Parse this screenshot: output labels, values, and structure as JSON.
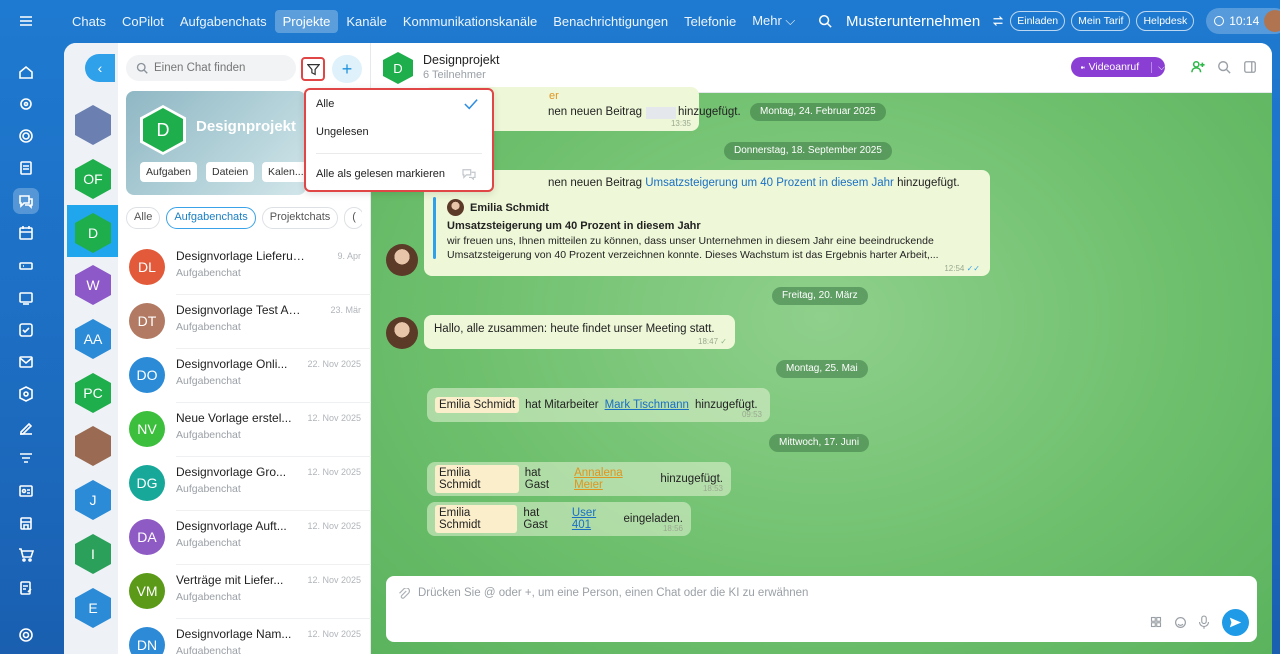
{
  "topnav": {
    "items": [
      "Chats",
      "CoPilot",
      "Aufgabenchats",
      "Projekte",
      "Kanäle",
      "Kommunikationskanäle",
      "Benachrichtigungen",
      "Telefonie",
      "Mehr ⌵"
    ],
    "active_index": 3
  },
  "header_right": {
    "org_name": "Musterunternehmen",
    "invite": "Einladen",
    "tariff": "Mein Tarif",
    "helpdesk": "Helpdesk",
    "time": "10:14"
  },
  "chatlist": {
    "search_placeholder": "Einen Chat finden",
    "banner": {
      "letter": "D",
      "title": "Designprojekt",
      "chips": [
        "Aufgaben",
        "Dateien",
        "Kalen..."
      ]
    },
    "tabs": [
      "Alle",
      "Aufgabenchats",
      "Projektchats",
      "("
    ],
    "rows": [
      {
        "initials": "DL",
        "title": "Designvorlage Lieferung ...",
        "subtitle": "Aufgabenchat",
        "date": "9. Apr",
        "color": "#e25a3a"
      },
      {
        "initials": "DT",
        "title": "Designvorlage Test Auft...",
        "subtitle": "Aufgabenchat",
        "date": "23. Mär",
        "color": "#b27a62"
      },
      {
        "initials": "DO",
        "title": "Designvorlage Onli...",
        "subtitle": "Aufgabenchat",
        "date": "22. Nov 2025",
        "color": "#2b8bd6"
      },
      {
        "initials": "NV",
        "title": "Neue Vorlage erstel...",
        "subtitle": "Aufgabenchat",
        "date": "12. Nov 2025",
        "color": "#3cbf3c"
      },
      {
        "initials": "DG",
        "title": "Designvorlage Gro...",
        "subtitle": "Aufgabenchat",
        "date": "12. Nov 2025",
        "color": "#17a89a"
      },
      {
        "initials": "DA",
        "title": "Designvorlage Auft...",
        "subtitle": "Aufgabenchat",
        "date": "12. Nov 2025",
        "color": "#8e5ac4"
      },
      {
        "initials": "VM",
        "title": "Verträge mit Liefer...",
        "subtitle": "Aufgabenchat",
        "date": "12. Nov 2025",
        "color": "#5a9a18"
      },
      {
        "initials": "DN",
        "title": "Designvorlage Nam...",
        "subtitle": "Aufgabenchat",
        "date": "12. Nov 2025",
        "color": "#2d8ad6"
      }
    ]
  },
  "avatar_column": [
    {
      "label": "",
      "color": "#6b7fb0"
    },
    {
      "label": "OF",
      "color": "#1fae4c"
    },
    {
      "label": "D",
      "color": "#1fae4c"
    },
    {
      "label": "W",
      "color": "#8d58c7"
    },
    {
      "label": "AA",
      "color": "#2b8bd6"
    },
    {
      "label": "PC",
      "color": "#1fae4c"
    },
    {
      "label": "",
      "color": "#9a6a52"
    },
    {
      "label": "J",
      "color": "#2b8bd6"
    },
    {
      "label": "I",
      "color": "#2aa05a"
    },
    {
      "label": "E",
      "color": "#2b8bd6"
    }
  ],
  "filter_menu": {
    "all": "Alle",
    "unread": "Ungelesen",
    "mark_read": "Alle als gelesen markieren"
  },
  "chat_header": {
    "letter": "D",
    "title": "Designprojekt",
    "subtitle": "6 Teilnehmer",
    "video_call": "Videoanruf"
  },
  "messages": {
    "m1_sender_fragment": "er",
    "m1_text_before": "nen neuen Beitrag",
    "m1_text_after": "hinzugefügt.",
    "m1_time": "13:35",
    "date1": "Montag, 24. Februar 2025",
    "date2": "Donnerstag, 18. September 2025",
    "m2_text_before": "nen neuen Beitrag",
    "m2_link": "Umsatzsteigerung um 40 Prozent in diesem Jahr",
    "m2_text_after": "hinzugefügt.",
    "m2_quote_author": "Emilia Schmidt",
    "m2_quote_title": "Umsatzsteigerung um 40 Prozent in diesem Jahr",
    "m2_quote_line1": "wir freuen uns, Ihnen mitteilen zu können, dass unser Unternehmen in diesem Jahr eine beeindruckende",
    "m2_quote_line2": "Umsatzsteigerung von 40 Prozent verzeichnen konnte. Dieses Wachstum ist das Ergebnis harter Arbeit,...",
    "m2_time": "12:54",
    "date3": "Freitag, 20. März",
    "m3_text": "Hallo, alle zusammen: heute findet unser Meeting statt.",
    "m3_time": "18:47",
    "date4": "Montag, 25. Mai",
    "s1_name": "Emilia Schmidt",
    "s1_text": "hat Mitarbeiter",
    "s1_link": "Mark Tischmann",
    "s1_after": "hinzugefügt.",
    "s1_time": "09:53",
    "date5": "Mittwoch, 17. Juni",
    "s2_name": "Emilia Schmidt",
    "s2_text": "hat Gast",
    "s2_link": "Annalena Meier",
    "s2_after": "hinzugefügt.",
    "s2_time": "18:53",
    "s3_name": "Emilia Schmidt",
    "s3_text": "hat Gast",
    "s3_link": "User 401",
    "s3_after": "eingeladen.",
    "s3_time": "18:56"
  },
  "composer": {
    "placeholder": "Drücken Sie @ oder +, um eine Person, einen Chat oder die KI zu erwähnen"
  }
}
